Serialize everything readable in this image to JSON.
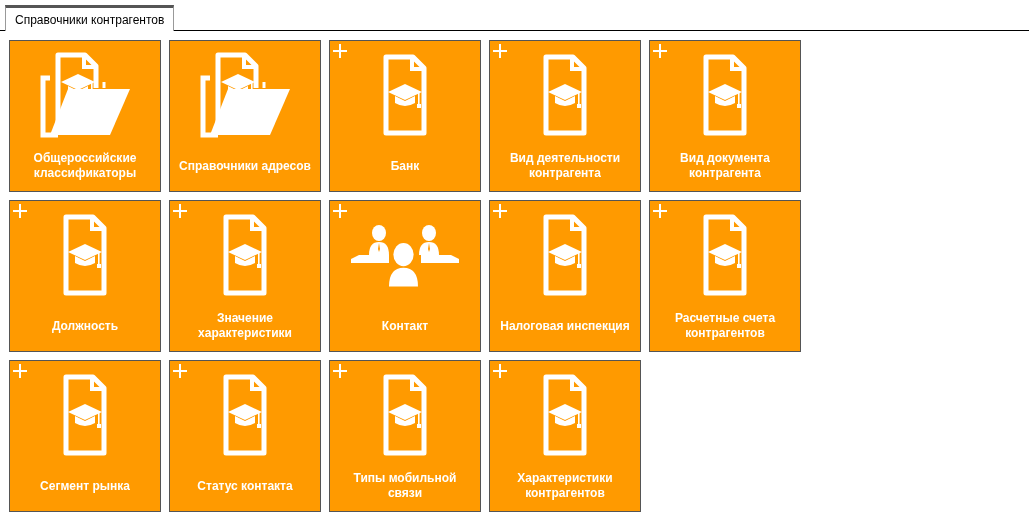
{
  "tabs": [
    {
      "label": "Справочники контрагентов",
      "selected": true
    }
  ],
  "tiles": [
    {
      "label": "Общероссийские классификаторы",
      "kind": "folder",
      "can_add": false
    },
    {
      "label": "Справочники адресов",
      "kind": "folder",
      "can_add": false
    },
    {
      "label": "Банк",
      "kind": "document",
      "can_add": true
    },
    {
      "label": "Вид деятельности контрагента",
      "kind": "document",
      "can_add": true
    },
    {
      "label": "Вид документа контрагента",
      "kind": "document",
      "can_add": true
    },
    {
      "label": "Должность",
      "kind": "document",
      "can_add": true
    },
    {
      "label": "Значение характеристики",
      "kind": "document",
      "can_add": true
    },
    {
      "label": "Контакт",
      "kind": "people",
      "can_add": true
    },
    {
      "label": "Налоговая инспекция",
      "kind": "document",
      "can_add": true
    },
    {
      "label": "Расчетные счета контрагентов",
      "kind": "document",
      "can_add": true
    },
    {
      "label": "Сегмент рынка",
      "kind": "document",
      "can_add": true
    },
    {
      "label": "Статус контакта",
      "kind": "document",
      "can_add": true
    },
    {
      "label": "Типы мобильной связи",
      "kind": "document",
      "can_add": true
    },
    {
      "label": "Характеристики контрагентов",
      "kind": "document",
      "can_add": true
    }
  ]
}
